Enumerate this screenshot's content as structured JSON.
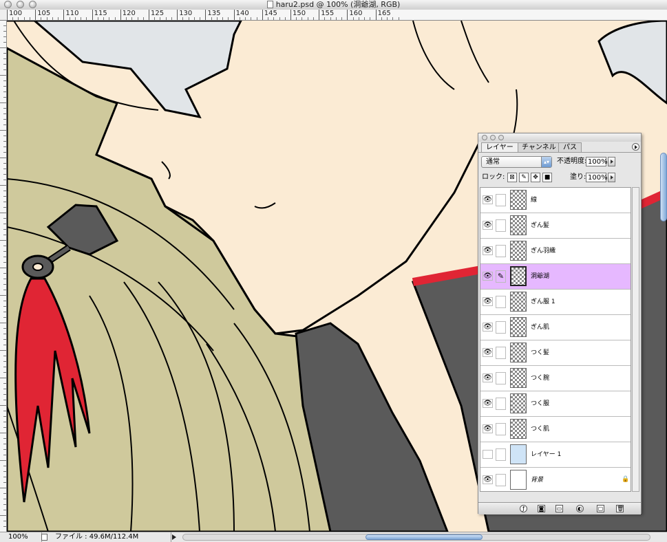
{
  "window": {
    "title": "haru2.psd @ 100% (洞爺湖, RGB)"
  },
  "ruler": {
    "labels": [
      "100",
      "105",
      "110",
      "115",
      "120",
      "125",
      "130",
      "135",
      "140",
      "145",
      "150",
      "155",
      "160",
      "165"
    ]
  },
  "statusbar": {
    "zoom": "100%",
    "file_info": "ファイル : 49.6M/112.4M"
  },
  "layers_panel": {
    "tabs": [
      "レイヤー",
      "チャンネル",
      "パス"
    ],
    "blend_mode": "通常",
    "opacity_label": "不透明度:",
    "opacity_value": "100%",
    "lock_label": "ロック:",
    "fill_label": "塗り:",
    "fill_value": "100%",
    "layers": [
      {
        "name": "線",
        "visible": true,
        "active": false
      },
      {
        "name": "ぎん髪",
        "visible": true,
        "active": false
      },
      {
        "name": "ぎん羽織",
        "visible": true,
        "active": false
      },
      {
        "name": "洞爺湖",
        "visible": true,
        "active": true
      },
      {
        "name": "ぎん服 1",
        "visible": true,
        "active": false
      },
      {
        "name": "ぎん肌",
        "visible": true,
        "active": false
      },
      {
        "name": "つく髪",
        "visible": true,
        "active": false
      },
      {
        "name": "つく腕",
        "visible": true,
        "active": false
      },
      {
        "name": "つく服",
        "visible": true,
        "active": false
      },
      {
        "name": "つく肌",
        "visible": true,
        "active": false
      },
      {
        "name": "レイヤー 1",
        "visible": false,
        "active": false
      },
      {
        "name": "背景",
        "visible": true,
        "active": false,
        "locked": true
      }
    ]
  },
  "colors": {
    "skin": "#fbebd4",
    "hair_blonde": "#cfc99c",
    "hair_silver": "#e1e5e8",
    "clothing_gray": "#5a5a5a",
    "accent_red": "#e02534",
    "active_layer": "#e6b8ff"
  }
}
